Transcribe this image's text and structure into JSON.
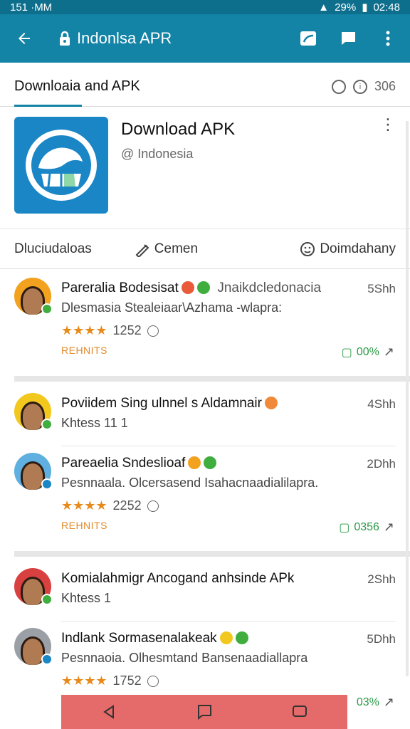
{
  "status": {
    "left": "151 ·MM",
    "battery": "29%",
    "time": "02:48"
  },
  "appbar": {
    "title": "Indonlsa APR"
  },
  "tabbar": {
    "tab": "Downloaia and APK",
    "count": "306"
  },
  "app": {
    "name": "Download APK",
    "sub": "@ Indonesia"
  },
  "actions": {
    "a1": "Dluciudaloas",
    "a2": "Cemen",
    "a3": "Doimdahany"
  },
  "items": [
    {
      "line1": "Pareralia Bodesisat",
      "line1b": "Jnaikdcledonacia",
      "line2": "Dlesmasia Stealeiaar\\Azhama -wlapra:",
      "time": "5Shh",
      "rating": "1252",
      "tag": "REHNITS",
      "pct": "00%"
    },
    {
      "line1": "Poviidem Sing ulnnel s Aldamnair",
      "line2": "Khtess 11 1",
      "time": "4Shh"
    },
    {
      "line1": "Pareaelia Sndeslioaf",
      "line2": "Pesnnaala. Olcersasend Isahacnaadialilapra.",
      "time": "2Dhh",
      "rating": "2252",
      "tag": "REHNITS",
      "pct": "0356"
    },
    {
      "line1": "Komialahmigr Ancogand anhsinde APk",
      "line2": "Khtess 1",
      "time": "2Shh"
    },
    {
      "line1": "Indlank Sormasenalakeak",
      "line2": "Pesnnaoia. Olhesmtand Bansenaadiallapra",
      "time": "5Dhh",
      "rating": "1752",
      "pct": "03%"
    }
  ],
  "colors": {
    "primary": "#1383a6",
    "status": "#0e6f8d",
    "star": "#e88a1a",
    "success": "#2a9a45",
    "nav": "#e56a6a"
  },
  "icons": [
    "back-arrow-icon",
    "lock-icon",
    "window-icon",
    "chat-icon",
    "more-vert-icon",
    "info-icon",
    "clock-icon",
    "share-icon",
    "smiley-icon",
    "nav-back-icon",
    "nav-home-icon",
    "nav-recent-icon"
  ]
}
